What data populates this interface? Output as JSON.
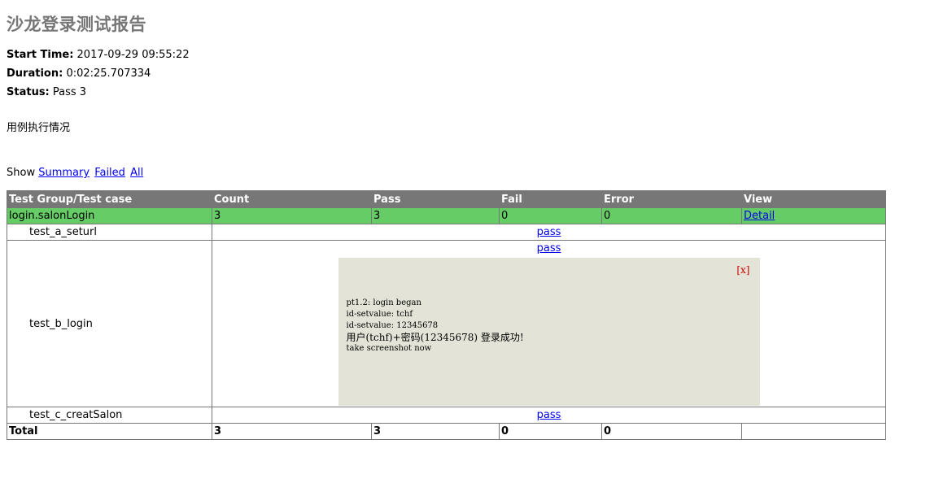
{
  "report": {
    "title": "沙龙登录测试报告",
    "start_time_label": "Start Time:",
    "start_time": "2017-09-29 09:55:22",
    "duration_label": "Duration:",
    "duration": "0:02:25.707334",
    "status_label": "Status:",
    "status": "Pass 3",
    "description": "用例执行情况"
  },
  "filter": {
    "show_label": "Show",
    "summary": "Summary",
    "failed": "Failed",
    "all": "All"
  },
  "table": {
    "headers": [
      "Test Group/Test case",
      "Count",
      "Pass",
      "Fail",
      "Error",
      "View"
    ],
    "group": {
      "name": "login.salonLogin",
      "count": "3",
      "pass": "3",
      "fail": "0",
      "error": "0",
      "view": "Detail",
      "color": "#66cc66"
    },
    "cases": [
      {
        "name": "test_a_seturl",
        "status": "pass"
      },
      {
        "name": "test_b_login",
        "status": "pass"
      },
      {
        "name": "test_c_creatSalon",
        "status": "pass"
      }
    ],
    "popup": {
      "close": "[x]",
      "lines": [
        "pt1.2: login began",
        "id-setvalue: tchf",
        "id-setvalue: 12345678",
        "用户(tchf)+密码(12345678) 登录成功!",
        "take screenshot now"
      ],
      "background": "#e3e4d7"
    },
    "total": {
      "label": "Total",
      "count": "3",
      "pass": "3",
      "fail": "0",
      "error": "0"
    }
  },
  "colors": {
    "header_bg": "#777777",
    "pass_bg": "#66cc66",
    "link": "#0000ee"
  }
}
